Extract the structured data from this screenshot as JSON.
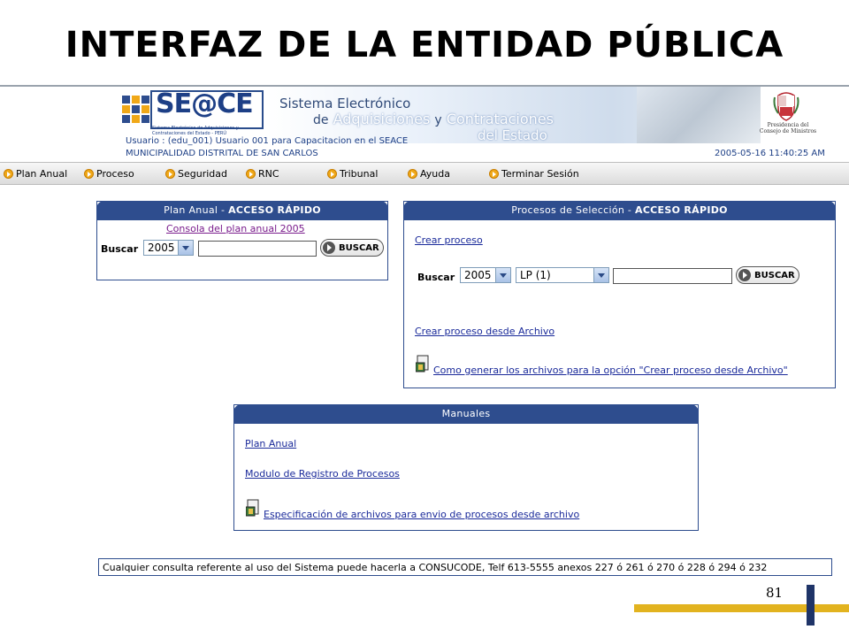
{
  "slide": {
    "title": "INTERFAZ DE LA ENTIDAD PÚBLICA",
    "page_number": "81"
  },
  "header": {
    "logo": "SE@CE",
    "logo_sub": "Sistema Electrónico de Adquisiciones y Contrataciones del Estado - PERÚ",
    "system_line1": "Sistema Electrónico",
    "system_line2_prefix": "de",
    "system_line2_a": "Adquisiciones",
    "system_line2_y": "y",
    "system_line2_b": "Contrataciones",
    "system_line3": "del Estado",
    "user": "Usuario : (edu_001) Usuario 001 para Capacitacion en el SEACE",
    "entity": "MUNICIPALIDAD DISTRITAL DE SAN CARLOS",
    "datetime": "2005-05-16 11:40:25 AM",
    "pcm": "Presidencia del Consejo de Ministros"
  },
  "menu": {
    "items": [
      "Plan Anual",
      "Proceso",
      "Seguridad",
      "RNC",
      "Tribunal",
      "Ayuda",
      "Terminar Sesión"
    ]
  },
  "plan_panel": {
    "title_normal": "Plan Anual -",
    "title_bold": "ACCESO RÁPIDO",
    "console_link": "Consola del plan anual 2005",
    "search_label": "Buscar",
    "year_value": "2005",
    "button": "BUSCAR"
  },
  "proc_panel": {
    "title_normal": "Procesos de Selección -",
    "title_bold": "ACCESO RÁPIDO",
    "create_link": "Crear proceso",
    "search_label": "Buscar",
    "year_value": "2005",
    "type_value": "LP (1)",
    "button": "BUSCAR",
    "create_file_link": "Crear proceso desde Archivo",
    "how_link": "Como generar los archivos para la opción \"Crear proceso desde Archivo\""
  },
  "manuals_panel": {
    "title": "Manuales",
    "link1": "Plan Anual",
    "link2": "Modulo de Registro de Procesos",
    "link3": "Especificación de archivos para envio de procesos desde archivo"
  },
  "footer": {
    "text": "Cualquier consulta referente al uso del Sistema puede hacerla a CONSUCODE, Telf 613-5555 anexos 227 ó 261 ó 270 ó 228 ó 294 ó 232"
  },
  "colors": {
    "navy": "#2e4d8e",
    "gold": "#e2b31f",
    "link": "#1a2a9a"
  }
}
